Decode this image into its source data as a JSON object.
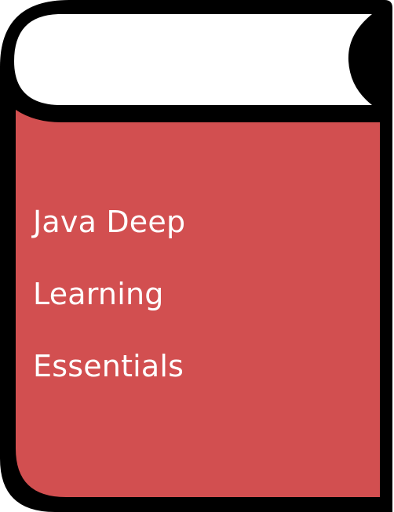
{
  "book": {
    "title_lines": [
      "Java Deep",
      "Learning",
      "Essentials"
    ],
    "cover_color": "#d24f50",
    "outline_color": "#000000",
    "page_color": "#ffffff",
    "icon": "book-icon"
  }
}
